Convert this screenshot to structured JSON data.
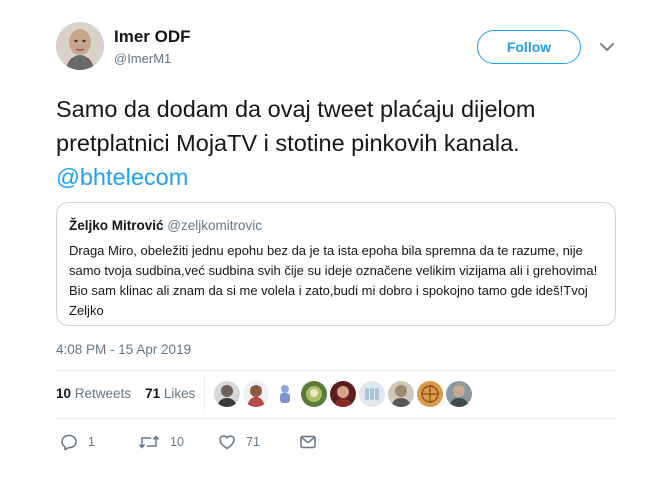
{
  "author": {
    "name": "Imer ODF",
    "handle": "@ImerM1"
  },
  "follow_label": "Follow",
  "tweet": {
    "text": "Samo da dodam da ovaj tweet plaćaju dijelom pretplatnici MojaTV i stotine pinkovih kanala.",
    "mention": "@bhtelecom"
  },
  "quoted": {
    "name": "Željko Mitrović",
    "handle": "@zeljkomitrovic",
    "text": "Draga Miro, obeležiti jednu epohu bez da je ta ista epoha bila spremna da te razume, nije samo tvoja sudbina,već sudbina svih čije su ideje označene velikim vizijama ali i grehovima! Bio sam klinac ali znam da si me volela i zato,budi mi dobro i spokojno tamo gde ideš!Tvoj Zeljko"
  },
  "timestamp": "4:08 PM - 15 Apr 2019",
  "stats": {
    "retweets_count": "10",
    "retweets_label": "Retweets",
    "likes_count": "71",
    "likes_label": "Likes"
  },
  "actions": {
    "reply_count": "1",
    "retweet_count": "10",
    "like_count": "71"
  },
  "icons": [
    "chevron-down-icon",
    "reply-icon",
    "retweet-icon",
    "heart-icon",
    "message-icon"
  ],
  "colors": {
    "accent": "#1da1f2",
    "secondary_text": "#657786",
    "border": "#ccd6dd"
  }
}
